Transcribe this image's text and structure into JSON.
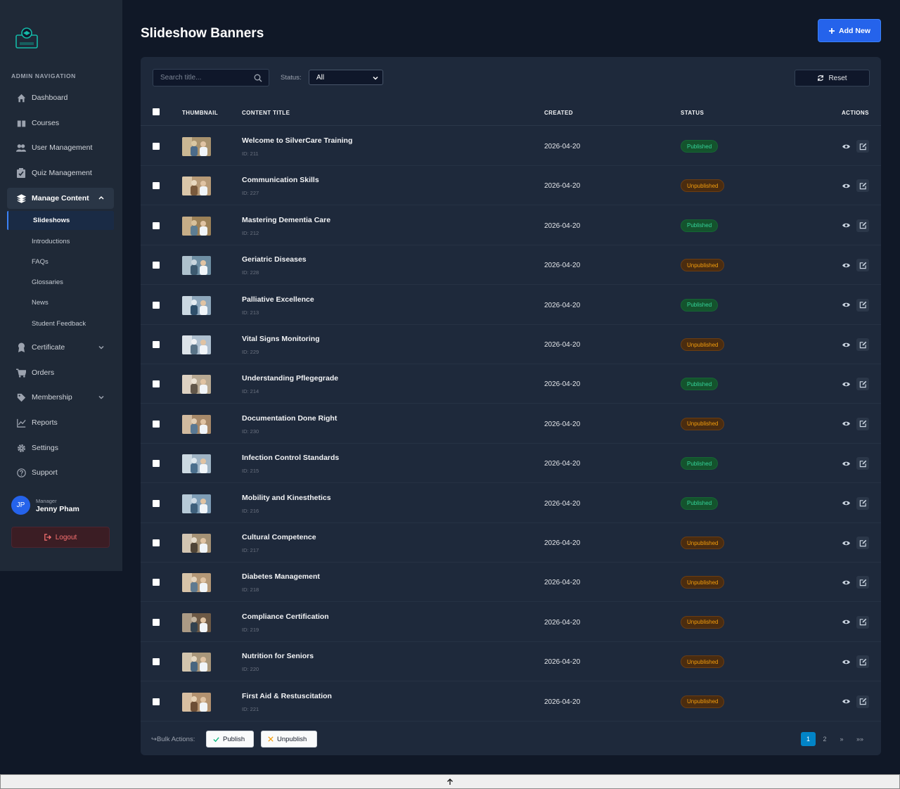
{
  "sidebar": {
    "nav_heading": "ADMIN NAVIGATION",
    "items": [
      {
        "label": "Dashboard",
        "icon": "home-icon"
      },
      {
        "label": "Courses",
        "icon": "book-icon"
      },
      {
        "label": "User Management",
        "icon": "users-icon"
      },
      {
        "label": "Quiz Management",
        "icon": "clipboard-check-icon"
      },
      {
        "label": "Manage Content",
        "icon": "layers-icon"
      },
      {
        "label": "Certificate",
        "icon": "award-icon"
      },
      {
        "label": "Orders",
        "icon": "cart-icon"
      },
      {
        "label": "Membership",
        "icon": "tag-icon"
      },
      {
        "label": "Reports",
        "icon": "chart-line-icon"
      },
      {
        "label": "Settings",
        "icon": "gear-icon"
      },
      {
        "label": "Support",
        "icon": "help-icon"
      }
    ],
    "sub_items": [
      "Slideshows",
      "Introductions",
      "FAQs",
      "Glossaries",
      "News",
      "Student Feedback"
    ],
    "user": {
      "initials": "JP",
      "role": "Manager",
      "name": "Jenny Pham"
    },
    "logout_label": "Logout"
  },
  "header": {
    "title": "Slideshow Banners",
    "add_label": "Add New"
  },
  "filters": {
    "search_placeholder": "Search title...",
    "status_label": "Status:",
    "status_value": "All",
    "reset_label": "Reset"
  },
  "table": {
    "columns": [
      "THUMBNAIL",
      "CONTENT TITLE",
      "CREATED",
      "STATUS",
      "ACTIONS"
    ],
    "rows": [
      {
        "title": "Welcome to SilverCare Training",
        "id": "ID: 211",
        "created": "2026-04-20",
        "status": "Published"
      },
      {
        "title": "Communication Skills",
        "id": "ID: 227",
        "created": "2026-04-20",
        "status": "Unpublished"
      },
      {
        "title": "Mastering Dementia Care",
        "id": "ID: 212",
        "created": "2026-04-20",
        "status": "Published"
      },
      {
        "title": "Geriatric Diseases",
        "id": "ID: 228",
        "created": "2026-04-20",
        "status": "Unpublished"
      },
      {
        "title": "Palliative Excellence",
        "id": "ID: 213",
        "created": "2026-04-20",
        "status": "Published"
      },
      {
        "title": "Vital Signs Monitoring",
        "id": "ID: 229",
        "created": "2026-04-20",
        "status": "Unpublished"
      },
      {
        "title": "Understanding Pflegegrade",
        "id": "ID: 214",
        "created": "2026-04-20",
        "status": "Published"
      },
      {
        "title": "Documentation Done Right",
        "id": "ID: 230",
        "created": "2026-04-20",
        "status": "Unpublished"
      },
      {
        "title": "Infection Control Standards",
        "id": "ID: 215",
        "created": "2026-04-20",
        "status": "Published"
      },
      {
        "title": "Mobility and Kinesthetics",
        "id": "ID: 216",
        "created": "2026-04-20",
        "status": "Published"
      },
      {
        "title": "Cultural Competence",
        "id": "ID: 217",
        "created": "2026-04-20",
        "status": "Unpublished"
      },
      {
        "title": "Diabetes Management",
        "id": "ID: 218",
        "created": "2026-04-20",
        "status": "Unpublished"
      },
      {
        "title": "Compliance Certification",
        "id": "ID: 219",
        "created": "2026-04-20",
        "status": "Unpublished"
      },
      {
        "title": "Nutrition for Seniors",
        "id": "ID: 220",
        "created": "2026-04-20",
        "status": "Unpublished"
      },
      {
        "title": "First Aid & Restuscitation",
        "id": "ID: 221",
        "created": "2026-04-20",
        "status": "Unpublished"
      }
    ]
  },
  "footer": {
    "bulk_label": "Bulk Actions:",
    "publish_label": "Publish",
    "unpublish_label": "Unpublish",
    "pages": [
      "1",
      "2",
      "»",
      "»»"
    ],
    "current_page": "1"
  },
  "colors": {
    "accent": "#2563eb",
    "published": "#34d399",
    "unpublished": "#f59e0b",
    "logout": "#f87171"
  }
}
